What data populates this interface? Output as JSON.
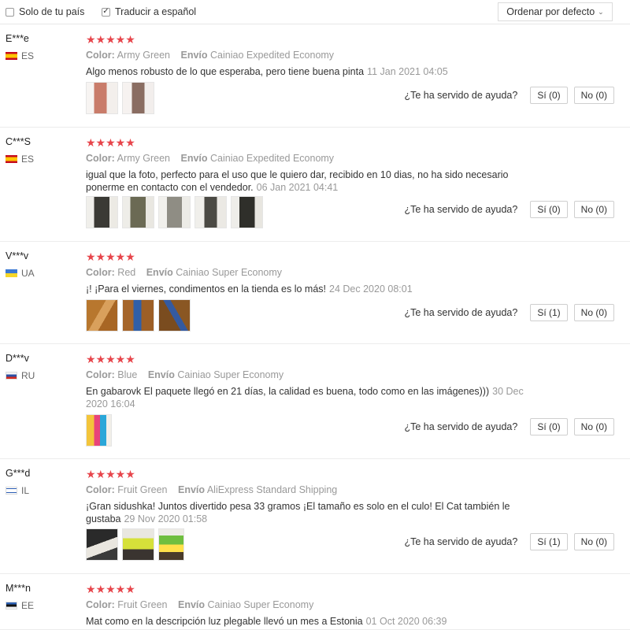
{
  "filters": {
    "own_country_label": "Solo de tu país",
    "own_country_checked": false,
    "translate_label": "Traducir a español",
    "translate_checked": true,
    "sort_label": "Ordenar por defecto",
    "check_mark": "✓",
    "chevron": "⌄"
  },
  "labels": {
    "color": "Color:",
    "shipping": "Envío",
    "helpful_question": "¿Te ha servido de ayuda?"
  },
  "reviews": [
    {
      "user": "E***e",
      "country": "ES",
      "stars": "★★★★★",
      "rating": 5,
      "color": "Army Green",
      "shipping": "Cainiao Expedited Economy",
      "text": "Algo menos robusto de lo que esperaba, pero tiene buena pinta",
      "date": "11 Jan 2021 04:05",
      "photo_count": 2,
      "yes": "Sí (0)",
      "no": "No (0)"
    },
    {
      "user": "C***S",
      "country": "ES",
      "stars": "★★★★★",
      "rating": 5,
      "color": "Army Green",
      "shipping": "Cainiao Expedited Economy",
      "text": "igual que la foto, perfecto para el uso que le quiero dar, recibido en 10 dias, no ha sido necesario ponerme en contacto con el vendedor.",
      "date": "06 Jan 2021 04:41",
      "photo_count": 5,
      "yes": "Sí (0)",
      "no": "No (0)"
    },
    {
      "user": "V***v",
      "country": "UA",
      "stars": "★★★★★",
      "rating": 5,
      "color": "Red",
      "shipping": "Cainiao Super Economy",
      "text": "¡! ¡Para el viernes, condimentos en la tienda es lo más!",
      "date": "24 Dec 2020 08:01",
      "photo_count": 3,
      "yes": "Sí (1)",
      "no": "No (0)"
    },
    {
      "user": "D***v",
      "country": "RU",
      "stars": "★★★★★",
      "rating": 5,
      "color": "Blue",
      "shipping": "Cainiao Super Economy",
      "text": "En gabarovk El paquete llegó en 21 días, la calidad es buena, todo como en las imágenes)))",
      "date": "30 Dec 2020 16:04",
      "photo_count": 1,
      "yes": "Sí (0)",
      "no": "No (0)"
    },
    {
      "user": "G***d",
      "country": "IL",
      "stars": "★★★★★",
      "rating": 5,
      "color": "Fruit Green",
      "shipping": "AliExpress Standard Shipping",
      "text": "¡Gran sidushka! Juntos divertido pesa 33 gramos ¡El tamaño es solo en el culo! El Cat también le gustaba",
      "date": "29 Nov 2020 01:58",
      "photo_count": 3,
      "yes": "Sí (1)",
      "no": "No (0)"
    },
    {
      "user": "M***n",
      "country": "EE",
      "stars": "★★★★★",
      "rating": 5,
      "color": "Fruit Green",
      "shipping": "Cainiao Super Economy",
      "text": "Mat como en la descripción luz plegable llevó un mes a Estonia",
      "date": "01 Oct 2020 06:39",
      "photo_count": 0,
      "yes": "",
      "no": ""
    }
  ],
  "colors": {
    "star": "#e7454b",
    "muted": "#999999"
  }
}
